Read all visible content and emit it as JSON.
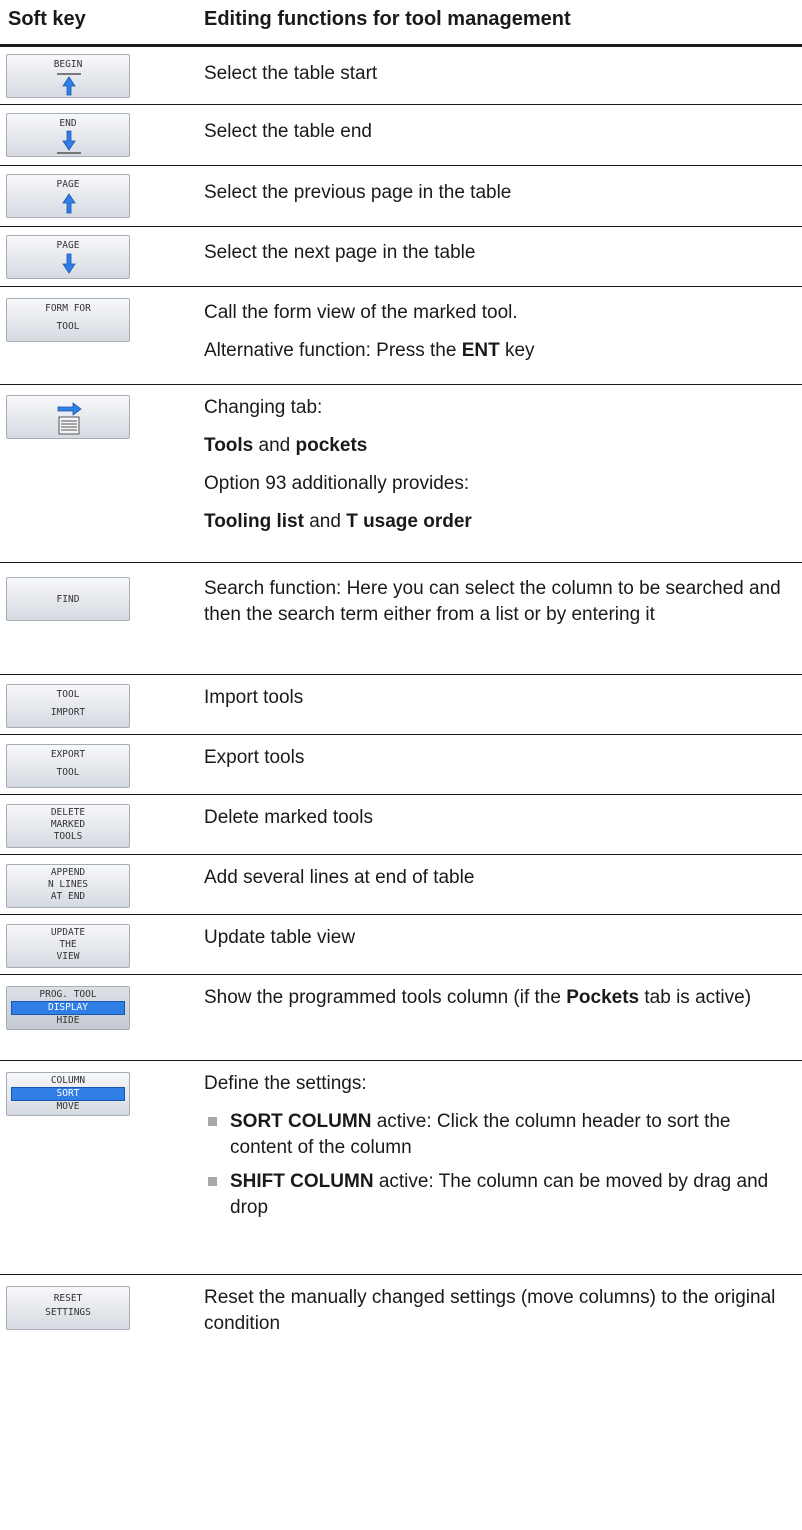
{
  "header": {
    "col1": "Soft key",
    "col2": "Editing functions for tool management"
  },
  "rows": [
    {
      "key": {
        "lines": [
          "BEGIN"
        ],
        "icon": "arrow-up-to-line-icon"
      },
      "desc": [
        "Select the table start"
      ]
    },
    {
      "key": {
        "lines": [
          "END"
        ],
        "icon": "arrow-down-to-line-icon"
      },
      "desc": [
        "Select the table end"
      ]
    },
    {
      "key": {
        "lines": [
          "PAGE"
        ],
        "icon": "arrow-up-icon"
      },
      "desc": [
        "Select the previous page in the table"
      ]
    },
    {
      "key": {
        "lines": [
          "PAGE"
        ],
        "icon": "arrow-down-icon"
      },
      "desc": [
        "Select the next page in the table"
      ]
    },
    {
      "key": {
        "lines": [
          "FORM FOR",
          "TOOL"
        ]
      },
      "desc": [
        "Call the form view of the marked tool.",
        "Alternative function: Press the ",
        "ENT",
        " key"
      ]
    },
    {
      "key": {
        "icon": "tab-switch-icon"
      },
      "desc": [
        "Changing tab:",
        "Tools",
        " and ",
        "pockets",
        "Option 93 additionally provides:",
        "Tooling list",
        " and ",
        "T usage order"
      ]
    },
    {
      "key": {
        "lines": [
          "FIND"
        ]
      },
      "desc": [
        "Search function: Here you can select the column to be searched and then the search term either from a list or by entering it"
      ]
    },
    {
      "key": {
        "lines": [
          "TOOL",
          "IMPORT"
        ]
      },
      "desc": [
        "Import tools"
      ]
    },
    {
      "key": {
        "lines": [
          "EXPORT",
          "TOOL"
        ]
      },
      "desc": [
        "Export tools"
      ]
    },
    {
      "key": {
        "lines": [
          "DELETE",
          "MARKED",
          "TOOLS"
        ]
      },
      "desc": [
        "Delete marked tools"
      ]
    },
    {
      "key": {
        "lines": [
          "APPEND",
          "N LINES",
          "AT END"
        ]
      },
      "desc": [
        "Add several lines at end of table"
      ]
    },
    {
      "key": {
        "lines": [
          "UPDATE",
          "THE",
          "VIEW"
        ]
      },
      "desc": [
        "Update table view"
      ]
    },
    {
      "key": {
        "lines": [
          "PROG. TOOL",
          "DISPLAY",
          "HIDE"
        ]
      },
      "desc": [
        "Show the programmed tools column (if the ",
        "Pockets",
        " tab is active)"
      ]
    },
    {
      "key": {
        "lines": [
          "COLUMN",
          "SORT",
          "MOVE"
        ]
      },
      "desc": [
        "Define the settings:",
        "SORT COLUMN",
        " active: Click the column header to sort the content of the column",
        "SHIFT COLUMN",
        " active: The column can be moved by drag and drop"
      ]
    },
    {
      "key": {
        "lines": [
          "RESET",
          "SETTINGS"
        ]
      },
      "desc": [
        "Reset the manually changed settings (move columns) to the original condition"
      ]
    }
  ],
  "colors": {
    "key_highlight": "#2f7fe6",
    "arrow": "#2f7fe6",
    "rule": "#1a1a1a",
    "bullet": "#a8a8a8"
  }
}
